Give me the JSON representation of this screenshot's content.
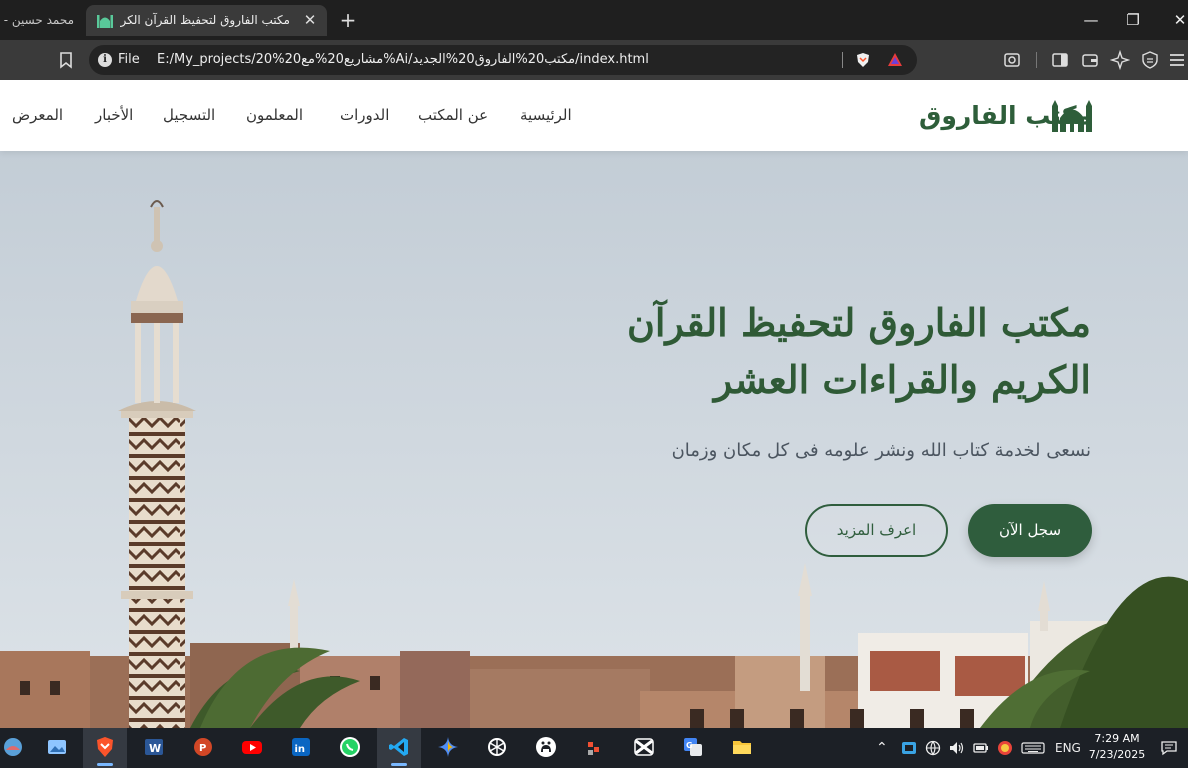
{
  "browser": {
    "prev_tab_title": "محمد حسين - ج",
    "active_tab_title": "مكتب الفاروق لتحفيظ القرآن الكريم",
    "tab_close_glyph": "✕",
    "new_tab_glyph": "+",
    "window_controls": {
      "minimize": "—",
      "maximize": "❐",
      "close": "✕"
    },
    "url_scheme": "File",
    "url": "E:/My_projects/20%مشاريع20%مع20%Ai/مكتب20%الفاروق20%الجديد/index.html",
    "icons": [
      "bookmark-icon",
      "info-icon",
      "brave-shield-icon",
      "brave-rewards-icon",
      "screenshot-icon",
      "sidebar-icon",
      "wallet-icon",
      "leo-ai-icon",
      "vpn-icon",
      "menu-icon"
    ]
  },
  "site": {
    "brand": "مكتب الفاروق",
    "brand_color": "#2e5e3a",
    "nav": [
      "الرئيسية",
      "عن المكتب",
      "الدورات",
      "المعلمون",
      "التسجيل",
      "الأخبار",
      "المعرض"
    ],
    "hero": {
      "title_line1": "مكتب الفاروق لتحفيظ القرآن",
      "title_line2": "الكريم والقراءات العشر",
      "subtitle": "نسعى لخدمة كتاب الله ونشر علومه فى كل مكان وزمان",
      "primary_button": "سجل الآن",
      "secondary_button": "اعرف المزيد"
    }
  },
  "taskbar": {
    "apps": [
      "widgets-icon",
      "photos-icon",
      "brave-icon",
      "word-icon",
      "powerpoint-icon",
      "youtube-icon",
      "linkedin-icon",
      "whatsapp-icon",
      "vscode-icon",
      "gemini-icon",
      "chatgpt-icon",
      "github-icon",
      "git-icon",
      "capcut-icon",
      "google-translate-icon",
      "file-explorer-icon"
    ],
    "tray_language": "ENG",
    "time": "7:29 AM",
    "date": "7/23/2025"
  }
}
